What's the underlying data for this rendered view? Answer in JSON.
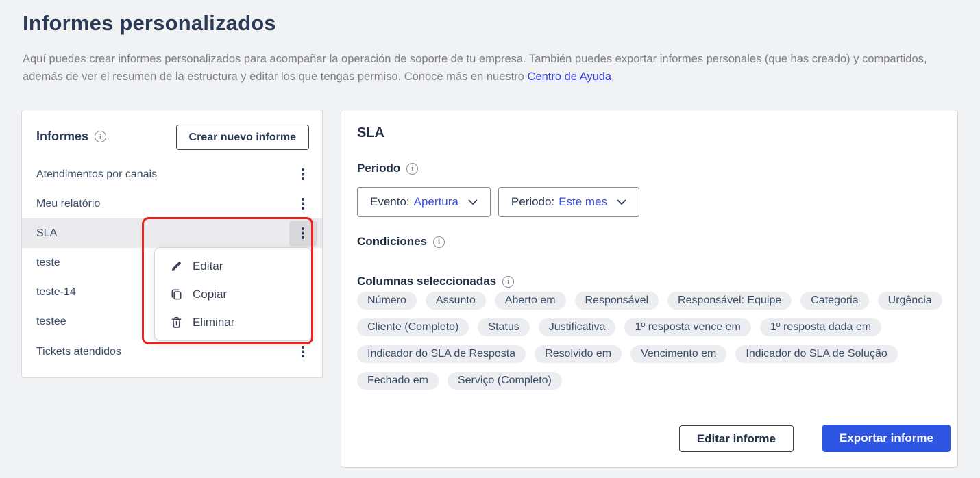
{
  "page": {
    "title": "Informes personalizados",
    "description_before_link": "Aquí puedes crear informes personalizados para acompañar la operación de soporte de tu empresa. También puedes exportar informes personales (que has creado) y compartidos, además de ver el resumen de la estructura y editar los que tengas permiso. Conoce más en nuestro ",
    "help_link_label": "Centro de Ayuda",
    "description_after_link": "."
  },
  "reports_panel": {
    "title": "Informes",
    "create_button_label": "Crear nuevo informe",
    "items": [
      {
        "label": "Atendimentos por canais",
        "selected": false
      },
      {
        "label": "Meu relatório",
        "selected": false
      },
      {
        "label": "SLA",
        "selected": true
      },
      {
        "label": "teste",
        "selected": false
      },
      {
        "label": "teste-14",
        "selected": false
      },
      {
        "label": "testee",
        "selected": false
      },
      {
        "label": "Tickets atendidos",
        "selected": false
      }
    ],
    "context_menu": {
      "items": [
        {
          "label": "Editar",
          "icon": "pencil-icon"
        },
        {
          "label": "Copiar",
          "icon": "copy-icon"
        },
        {
          "label": "Eliminar",
          "icon": "trash-icon"
        }
      ]
    }
  },
  "detail_panel": {
    "title": "SLA",
    "period_section_label": "Periodo",
    "event_dropdown": {
      "label": "Evento:",
      "value": "Apertura"
    },
    "period_dropdown": {
      "label": "Periodo:",
      "value": "Este mes"
    },
    "conditions_section_label": "Condiciones",
    "columns_section_label": "Columnas seleccionadas",
    "columns": [
      "Número",
      "Assunto",
      "Aberto em",
      "Responsável",
      "Responsável: Equipe",
      "Categoria",
      "Urgência",
      "Cliente (Completo)",
      "Status",
      "Justificativa",
      "1º resposta vence em",
      "1º resposta dada em",
      "Indicador do SLA de Resposta",
      "Resolvido em",
      "Vencimento em",
      "Indicador do SLA de Solução",
      "Fechado em",
      "Serviço (Completo)"
    ],
    "edit_button_label": "Editar informe",
    "export_button_label": "Exportar informe"
  },
  "colors": {
    "accent_blue": "#2e55e2",
    "link_blue": "#3240df",
    "dropdown_value_blue": "#3c50e0",
    "annotation_red": "#e8251c",
    "heading_navy": "#2b3a55",
    "body_text": "#3d4f68",
    "muted_text": "#7d7e88",
    "chip_background": "#ebedf0",
    "selected_row_background": "#ebebee"
  }
}
